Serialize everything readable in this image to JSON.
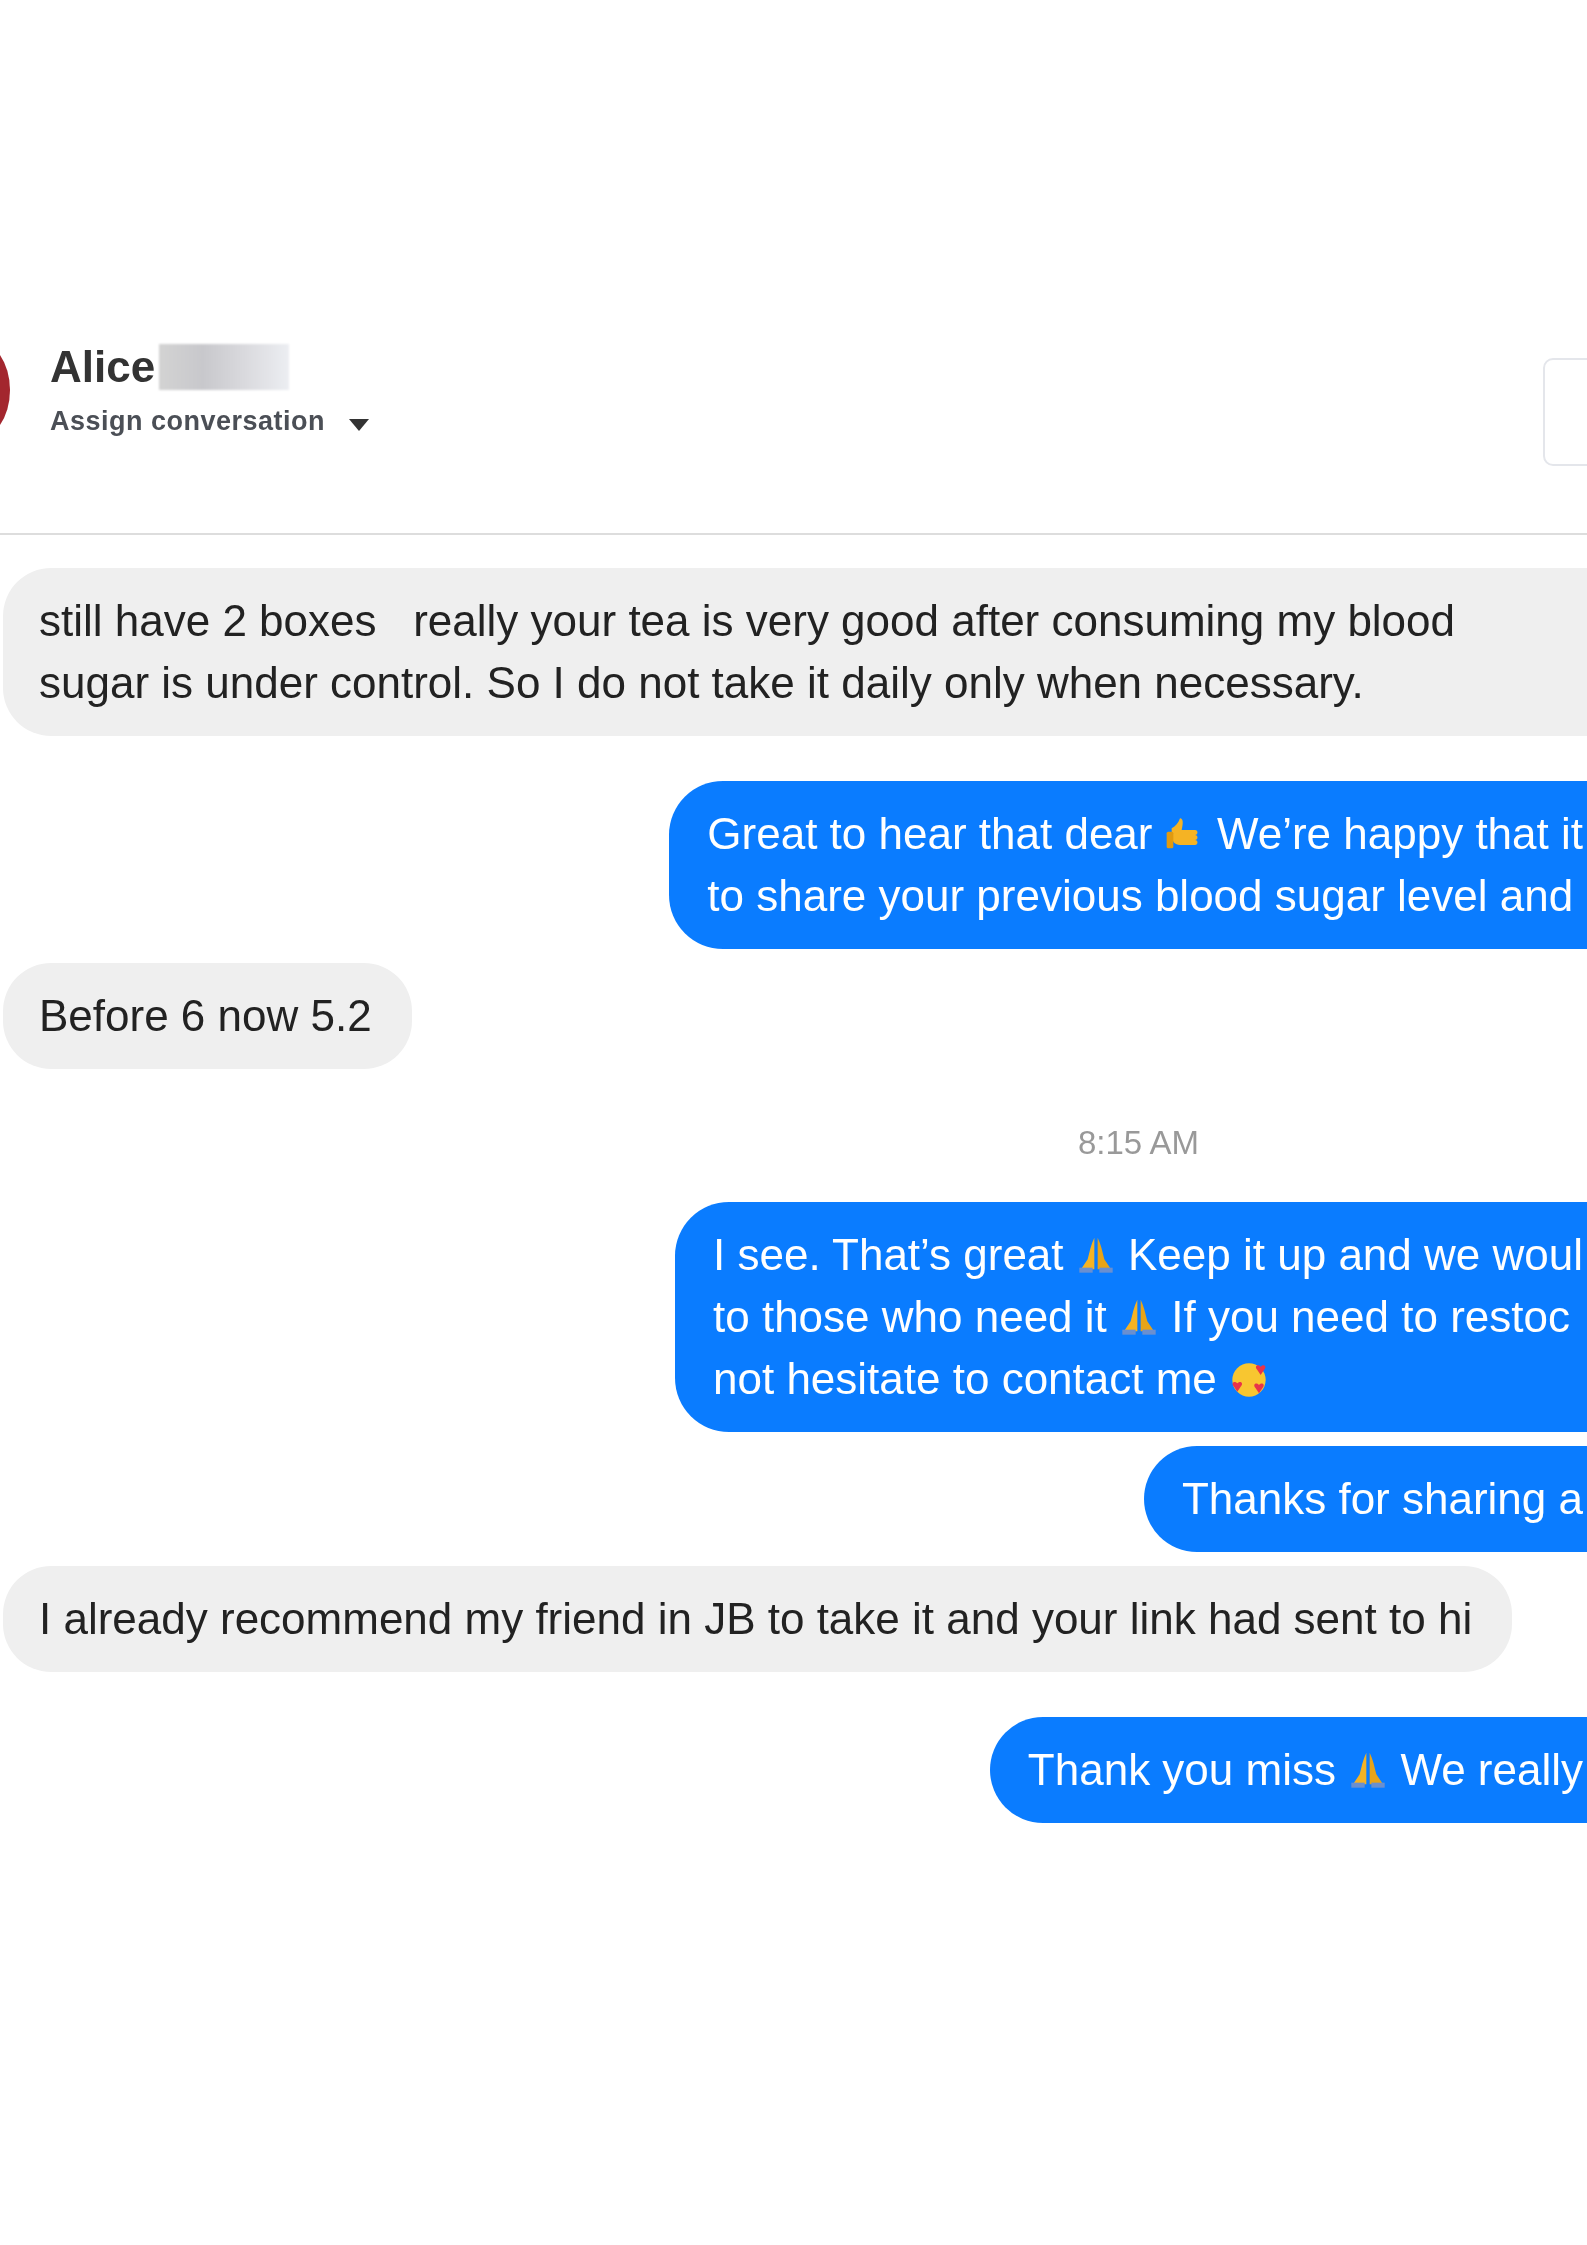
{
  "contact": {
    "name": "Alice",
    "assign_label": "Assign conversation"
  },
  "messages": [
    {
      "kind": "incoming",
      "lines": [
        [
          {
            "kind": "text",
            "text": "still have 2 boxes   really your tea is very good after consuming my blood"
          }
        ],
        [
          {
            "kind": "text",
            "text": "sugar is under control. So I do not take it daily only when necessary."
          }
        ]
      ]
    },
    {
      "kind": "outgoing",
      "lines": [
        [
          {
            "kind": "text",
            "text": "Great to hear that dear "
          },
          {
            "kind": "thumbs"
          },
          {
            "kind": "text",
            "text": " We’re happy that it"
          }
        ],
        [
          {
            "kind": "text",
            "text": "to share your previous blood sugar level and"
          }
        ]
      ]
    },
    {
      "kind": "incoming",
      "lines": [
        [
          {
            "kind": "text",
            "text": "Before 6 now 5.2"
          }
        ]
      ]
    },
    {
      "kind": "time",
      "text": "8:15 AM"
    },
    {
      "kind": "outgoing",
      "lines": [
        [
          {
            "kind": "text",
            "text": "I see. That’s great "
          },
          {
            "kind": "pray"
          },
          {
            "kind": "text",
            "text": " Keep it up and we woul"
          }
        ],
        [
          {
            "kind": "text",
            "text": "to those who need it "
          },
          {
            "kind": "pray"
          },
          {
            "kind": "text",
            "text": " If you need to restoc"
          }
        ],
        [
          {
            "kind": "text",
            "text": "not hesitate to contact me "
          },
          {
            "kind": "hearts"
          }
        ]
      ]
    },
    {
      "kind": "outgoing",
      "lines": [
        [
          {
            "kind": "text",
            "text": "Thanks for sharing a"
          }
        ]
      ]
    },
    {
      "kind": "incoming",
      "lines": [
        [
          {
            "kind": "text",
            "text": "I already recommend my friend in JB to take it and your link had sent to hi"
          }
        ]
      ]
    },
    {
      "kind": "outgoing",
      "lines": [
        [
          {
            "kind": "text",
            "text": "Thank you miss "
          },
          {
            "kind": "pray"
          },
          {
            "kind": "text",
            "text": " We really"
          }
        ]
      ]
    }
  ]
}
